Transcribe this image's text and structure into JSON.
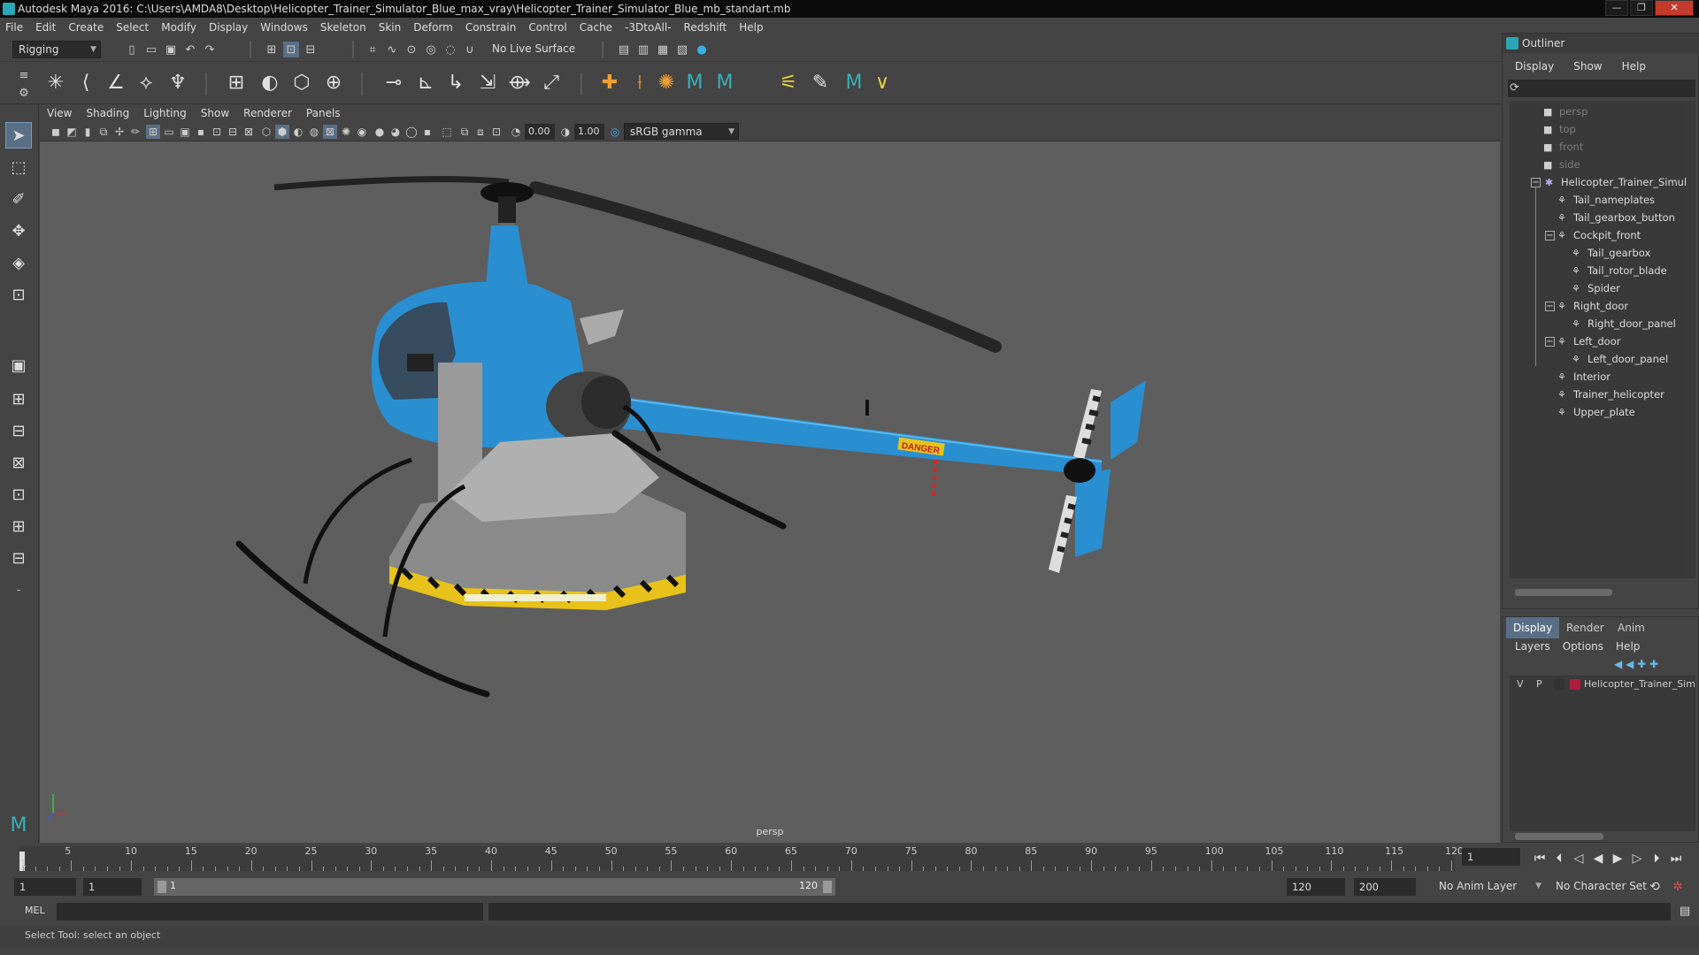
{
  "window": {
    "title": "Autodesk Maya 2016: C:\\Users\\AMDA8\\Desktop\\Helicopter_Trainer_Simulator_Blue_max_vray\\Helicopter_Trainer_Simulator_Blue_mb_standart.mb",
    "min_label": "—",
    "max_label": "❐",
    "close_label": "✕"
  },
  "menubar": [
    "File",
    "Edit",
    "Create",
    "Select",
    "Modify",
    "Display",
    "Windows",
    "Skeleton",
    "Skin",
    "Deform",
    "Constrain",
    "Control",
    "Cache",
    "-3DtoAll-",
    "Redshift",
    "Help"
  ],
  "statusline": {
    "mode": "Rigging",
    "live_surface": "No Live Surface"
  },
  "viewport": {
    "menu": [
      "View",
      "Shading",
      "Lighting",
      "Show",
      "Renderer",
      "Panels"
    ],
    "exposure": "0.00",
    "gamma": "1.00",
    "color_space": "sRGB gamma",
    "camera_label": "persp",
    "scene_text": "DANGER"
  },
  "outliner": {
    "title": "Outliner",
    "menu": [
      "Display",
      "Show",
      "Help"
    ],
    "cameras": [
      "persp",
      "top",
      "front",
      "side"
    ],
    "root": "Helicopter_Trainer_Simulat",
    "items": [
      {
        "label": "Tail_nameplates",
        "depth": 1
      },
      {
        "label": "Tail_gearbox_button",
        "depth": 1
      },
      {
        "label": "Cockpit_front",
        "depth": 1,
        "expanded": true
      },
      {
        "label": "Tail_gearbox",
        "depth": 2
      },
      {
        "label": "Tail_rotor_blade",
        "depth": 2
      },
      {
        "label": "Spider",
        "depth": 2
      },
      {
        "label": "Right_door",
        "depth": 1,
        "expanded": true
      },
      {
        "label": "Right_door_panel",
        "depth": 2
      },
      {
        "label": "Left_door",
        "depth": 1,
        "expanded": true
      },
      {
        "label": "Left_door_panel",
        "depth": 2
      },
      {
        "label": "Interior",
        "depth": 1
      },
      {
        "label": "Trainer_helicopter",
        "depth": 1
      },
      {
        "label": "Upper_plate",
        "depth": 1
      }
    ]
  },
  "layers": {
    "tabs": [
      "Display",
      "Render",
      "Anim"
    ],
    "menu": [
      "Layers",
      "Options",
      "Help"
    ],
    "layer_row": {
      "v": "V",
      "p": "P",
      "name": "Helicopter_Trainer_Sim",
      "color": "#b01c3a"
    }
  },
  "timeline": {
    "ticks": [
      "5",
      "10",
      "15",
      "20",
      "25",
      "30",
      "35",
      "40",
      "45",
      "50",
      "55",
      "60",
      "65",
      "70",
      "75",
      "80",
      "85",
      "90",
      "95",
      "100",
      "105",
      "110",
      "115",
      "120"
    ],
    "start_marker": "1",
    "current_frame": "1"
  },
  "range": {
    "start": "1",
    "playback_start": "1",
    "range_start": "1",
    "range_end": "120",
    "playback_end": "120",
    "end": "200",
    "anim_layer": "No Anim Layer",
    "character_set": "No Character Set"
  },
  "cmdline": {
    "label": "MEL"
  },
  "helpline": {
    "text": "Select Tool: select an object"
  },
  "colors": {
    "accent": "#5a6f86",
    "heli_blue": "#2a8fd0",
    "hazard_yellow": "#e8c21a"
  }
}
